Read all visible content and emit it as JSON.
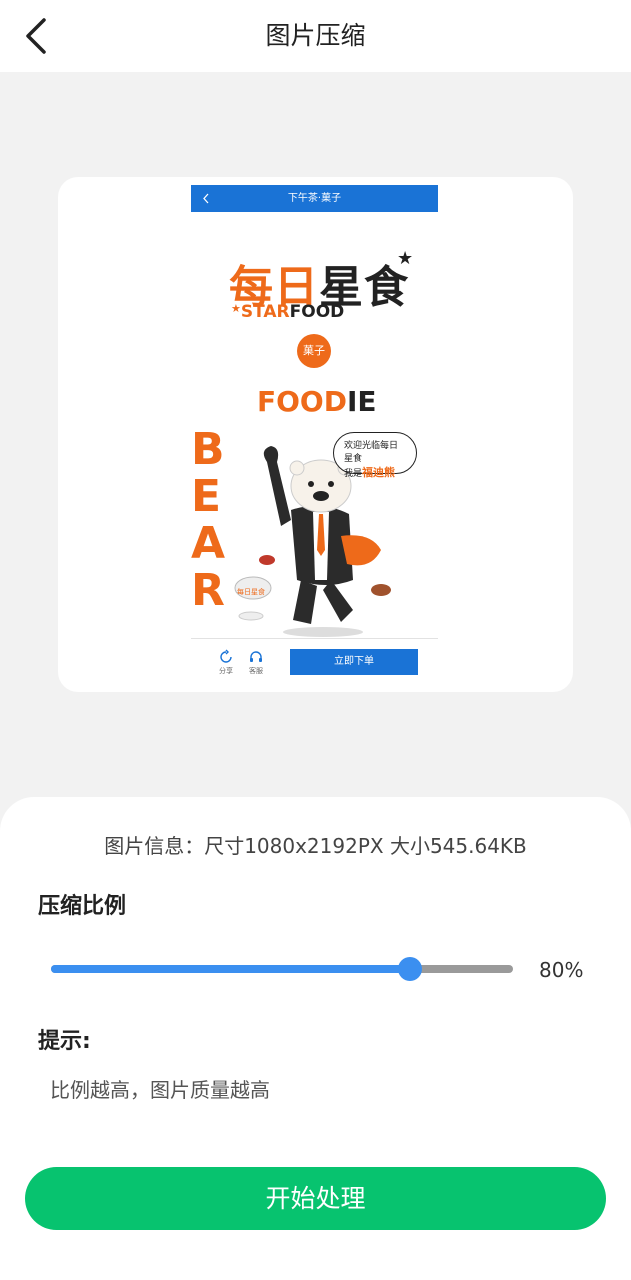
{
  "header": {
    "title": "图片压缩",
    "back_icon": "back-chevron-icon"
  },
  "preview": {
    "header_title": "下午茶·菓子",
    "logo_cn_orange": "每日",
    "logo_cn_dark": "星食",
    "logo_en_orange": "STAR",
    "logo_en_dark": "FOOD",
    "badge": "菓子",
    "foodie_orange": "FOOD",
    "foodie_dark": "IE",
    "bear_letters": [
      "B",
      "E",
      "A",
      "R"
    ],
    "speech_line1": "欢迎光临每日星食",
    "speech_line2_prefix": "我是",
    "speech_line2_name": "福迪熊",
    "share_label": "分享",
    "service_label": "客服",
    "order_button": "立即下单",
    "colors": {
      "brand_orange": "#ee6a1a",
      "header_blue": "#1a73d6"
    }
  },
  "panel": {
    "info": "图片信息：尺寸1080x2192PX 大小545.64KB",
    "ratio_label": "压缩比例",
    "slider": {
      "value": 80,
      "display": "80%",
      "fill_color": "#3b8ff0",
      "track_color": "#9a9a9a"
    },
    "hint_label": "提示:",
    "hint_text": "比例越高，图片质量越高",
    "start_button": "开始处理",
    "button_color": "#07c36f"
  }
}
